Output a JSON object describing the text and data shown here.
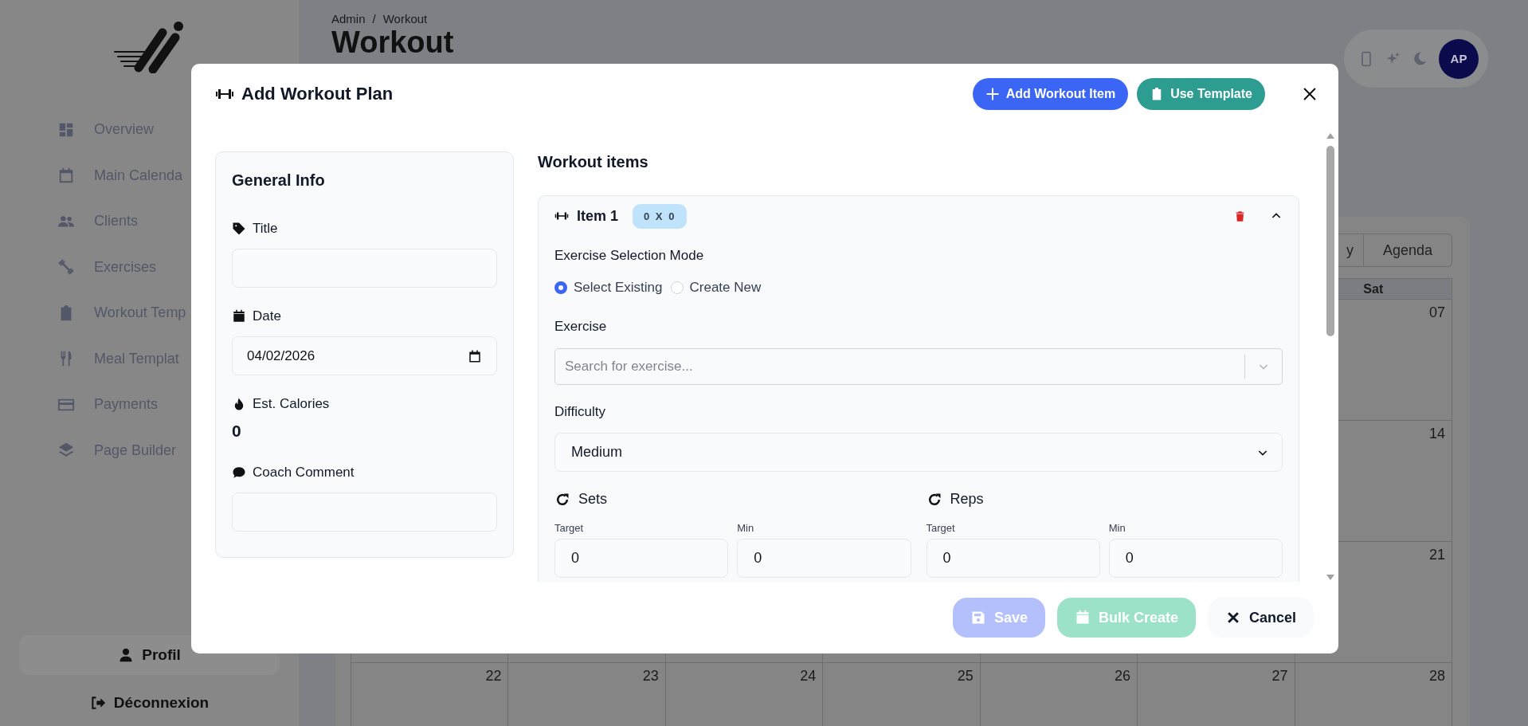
{
  "sidebar": {
    "nav": [
      {
        "label": "Overview"
      },
      {
        "label": "Main Calenda"
      },
      {
        "label": "Clients"
      },
      {
        "label": "Exercises"
      },
      {
        "label": "Workout Temp"
      },
      {
        "label": "Meal Templat"
      },
      {
        "label": "Payments"
      },
      {
        "label": "Page Builder"
      }
    ],
    "profile_button": "Profil",
    "logout_button": "Déconnexion"
  },
  "header": {
    "breadcrumb": [
      "Admin",
      "Workout"
    ],
    "breadcrumb_separator": "/",
    "title": "Workout",
    "avatar_initials": "AP"
  },
  "calendar": {
    "view_buttons": [
      "y",
      "Agenda"
    ],
    "weekday_header": {
      "sat": "Sat"
    },
    "weeks": [
      {
        "sat": "07"
      },
      {
        "sat": "14"
      },
      {
        "sat": "21"
      },
      {
        "sun": "22",
        "mon": "23",
        "tue": "24",
        "wed": "25",
        "thu": "26",
        "fri": "27",
        "sat": "28"
      }
    ]
  },
  "modal": {
    "title": "Add Workout Plan",
    "actions": [
      {
        "label": "Add Workout Item",
        "kind": "add"
      },
      {
        "label": "Use Template",
        "kind": "template"
      }
    ],
    "general_info": {
      "title": "General Info",
      "fields": [
        {
          "kind": "input",
          "label": "Title"
        },
        {
          "kind": "date",
          "label": "Date",
          "value": "04/02/2026"
        },
        {
          "kind": "readout",
          "label": "Est. Calories",
          "value": "0"
        },
        {
          "kind": "input",
          "label": "Coach Comment"
        }
      ]
    },
    "workout_items": {
      "heading": "Workout items",
      "items": [
        {
          "title": "Item 1",
          "badge": "0 X 0",
          "expanded": true,
          "mode_label": "Exercise Selection Mode",
          "modes": [
            {
              "label": "Select Existing",
              "selected": true
            },
            {
              "label": "Create New",
              "selected": false
            }
          ],
          "exercise_label": "Exercise",
          "exercise_placeholder": "Search for exercise...",
          "difficulty_label": "Difficulty",
          "difficulty": "Medium",
          "metrics": [
            {
              "label": "Sets",
              "target_label": "Target",
              "target": "0",
              "min_label": "Min",
              "min": "0"
            },
            {
              "label": "Reps",
              "target_label": "Target",
              "target": "0",
              "min_label": "Min",
              "min": "0"
            }
          ]
        }
      ]
    },
    "footer": [
      {
        "label": "Save",
        "kind": "save",
        "disabled": true
      },
      {
        "label": "Bulk Create",
        "kind": "bulk",
        "disabled": true
      },
      {
        "label": "Cancel",
        "kind": "cancel",
        "disabled": false
      }
    ]
  }
}
